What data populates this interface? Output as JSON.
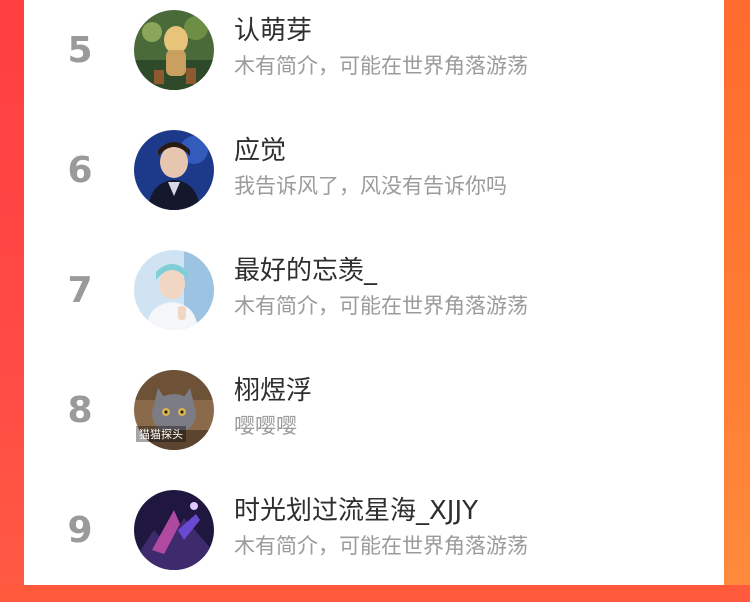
{
  "ranking": {
    "items": [
      {
        "rank": "5",
        "name": "认萌芽",
        "bio": "木有简介，可能在世界角落游荡"
      },
      {
        "rank": "6",
        "name": "应觉",
        "bio": "我告诉风了，风没有告诉你吗"
      },
      {
        "rank": "7",
        "name": "最好的忘羡_",
        "bio": "木有简介，可能在世界角落游荡"
      },
      {
        "rank": "8",
        "name": "栩煜浮",
        "bio": "嘤嘤嘤"
      },
      {
        "rank": "9",
        "name": "时光划过流星海_XJJY",
        "bio": "木有简介，可能在世界角落游荡"
      }
    ],
    "avatar_caption_8": "猫猫探头"
  }
}
